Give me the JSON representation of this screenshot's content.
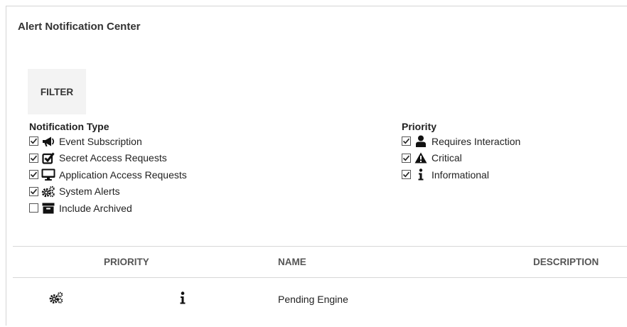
{
  "header": {
    "title": "Alert Notification Center"
  },
  "filter": {
    "button_label": "FILTER"
  },
  "notification_type": {
    "title": "Notification Type",
    "items": [
      {
        "label": "Event Subscription",
        "checked": true,
        "icon": "megaphone-icon"
      },
      {
        "label": "Secret Access Requests",
        "checked": true,
        "icon": "check-square-icon"
      },
      {
        "label": "Application Access Requests",
        "checked": true,
        "icon": "desktop-icon"
      },
      {
        "label": "System Alerts",
        "checked": true,
        "icon": "cogs-icon"
      },
      {
        "label": "Include Archived",
        "checked": false,
        "icon": "archive-icon"
      }
    ]
  },
  "priority": {
    "title": "Priority",
    "items": [
      {
        "label": "Requires Interaction",
        "checked": true,
        "icon": "user-icon"
      },
      {
        "label": "Critical",
        "checked": true,
        "icon": "warning-icon"
      },
      {
        "label": "Informational",
        "checked": true,
        "icon": "info-icon"
      }
    ]
  },
  "table": {
    "columns": {
      "priority": "PRIORITY",
      "name": "NAME",
      "description": "DESCRIPTION"
    },
    "rows": [
      {
        "type_icon": "cogs-icon",
        "priority_icon": "info-icon",
        "name": "Pending Engine",
        "description": ""
      }
    ]
  }
}
